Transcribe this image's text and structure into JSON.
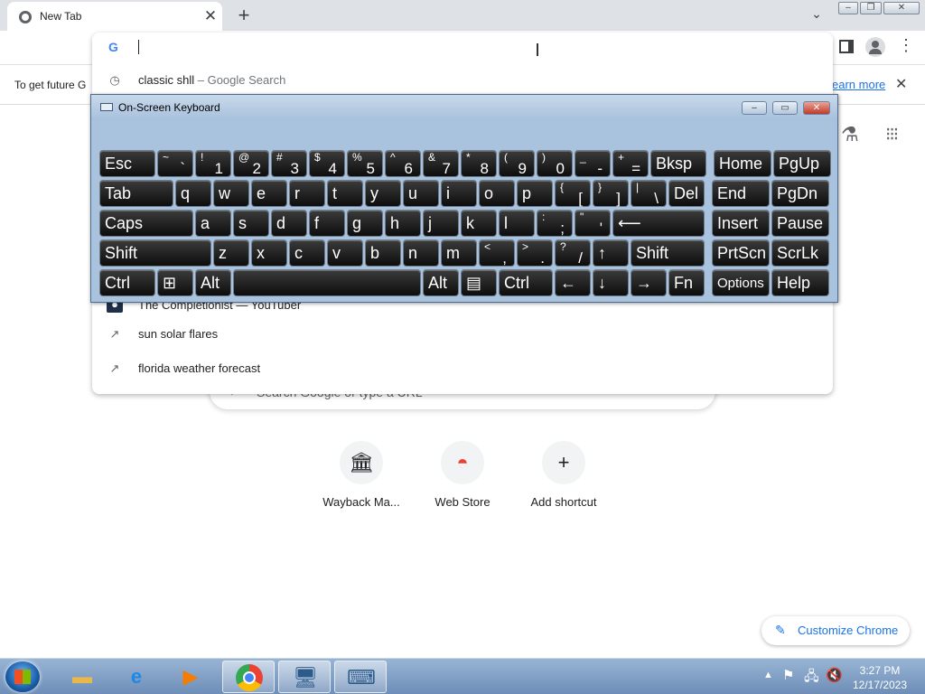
{
  "browser": {
    "tab_title": "New Tab",
    "omnibox_logo": "G",
    "info_text": "To get future G",
    "info_link": "earn more",
    "icons": [
      "chrome-icon",
      "close-icon",
      "plus-icon",
      "chevron-down-icon",
      "back-icon",
      "forward-icon",
      "reload-icon",
      "sidepanel-icon",
      "profile-icon",
      "menu-icon",
      "flask-icon",
      "apps-icon"
    ]
  },
  "omnibox": {
    "value": "",
    "suggestions": [
      {
        "text": "classic shll",
        "sub": " – Google Search",
        "icon": "history-icon"
      },
      {
        "text": "The Completionist — YouTuber",
        "sub": "",
        "icon": "person-icon"
      },
      {
        "text": "sun solar flares",
        "sub": "",
        "icon": "trending-icon"
      },
      {
        "text": "florida weather forecast",
        "sub": "",
        "icon": "trending-icon"
      }
    ]
  },
  "osk": {
    "title": "On-Screen Keyboard",
    "rows": [
      [
        {
          "m": "Esc"
        },
        {
          "s": "~",
          "m": "`"
        },
        {
          "s": "!",
          "m": "1"
        },
        {
          "s": "@",
          "m": "2"
        },
        {
          "s": "#",
          "m": "3"
        },
        {
          "s": "$",
          "m": "4"
        },
        {
          "s": "%",
          "m": "5"
        },
        {
          "s": "^",
          "m": "6"
        },
        {
          "s": "&",
          "m": "7"
        },
        {
          "s": "*",
          "m": "8"
        },
        {
          "s": "(",
          "m": "9"
        },
        {
          "s": ")",
          "m": "0"
        },
        {
          "s": "_",
          "m": "-"
        },
        {
          "s": "+",
          "m": "="
        },
        {
          "m": "Bksp"
        },
        {
          "m": "Home"
        },
        {
          "m": "PgUp"
        }
      ],
      [
        {
          "m": "Tab"
        },
        {
          "m": "q"
        },
        {
          "m": "w"
        },
        {
          "m": "e"
        },
        {
          "m": "r"
        },
        {
          "m": "t"
        },
        {
          "m": "y"
        },
        {
          "m": "u"
        },
        {
          "m": "i"
        },
        {
          "m": "o"
        },
        {
          "m": "p"
        },
        {
          "s": "{",
          "m": "["
        },
        {
          "s": "}",
          "m": "]"
        },
        {
          "s": "|",
          "m": "\\"
        },
        {
          "m": "Del"
        },
        {
          "m": "End"
        },
        {
          "m": "PgDn"
        }
      ],
      [
        {
          "m": "Caps"
        },
        {
          "m": "a"
        },
        {
          "m": "s"
        },
        {
          "m": "d"
        },
        {
          "m": "f"
        },
        {
          "m": "g"
        },
        {
          "m": "h"
        },
        {
          "m": "j"
        },
        {
          "m": "k"
        },
        {
          "m": "l"
        },
        {
          "s": ":",
          "m": ";"
        },
        {
          "s": "\"",
          "m": "'"
        },
        {
          "m": "⟵"
        },
        {
          "m": "Insert"
        },
        {
          "m": "Pause"
        }
      ],
      [
        {
          "m": "Shift"
        },
        {
          "m": "z"
        },
        {
          "m": "x"
        },
        {
          "m": "c"
        },
        {
          "m": "v"
        },
        {
          "m": "b"
        },
        {
          "m": "n"
        },
        {
          "m": "m"
        },
        {
          "s": "<",
          "m": ","
        },
        {
          "s": ">",
          "m": "."
        },
        {
          "s": "?",
          "m": "/"
        },
        {
          "m": "↑"
        },
        {
          "m": "Shift"
        },
        {
          "m": "PrtScn"
        },
        {
          "m": "ScrLk"
        }
      ],
      [
        {
          "m": "Ctrl"
        },
        {
          "m": "⊞"
        },
        {
          "m": "Alt"
        },
        {
          "m": ""
        },
        {
          "m": "Alt"
        },
        {
          "m": "▤"
        },
        {
          "m": "Ctrl"
        },
        {
          "m": "←"
        },
        {
          "m": "↓"
        },
        {
          "m": "→"
        },
        {
          "m": "Fn"
        },
        {
          "m": "Options"
        },
        {
          "m": "Help"
        }
      ]
    ]
  },
  "ntp": {
    "search_placeholder": "Search Google or type a URL",
    "shortcuts": [
      {
        "label": "Wayback Ma...",
        "icon": "wayback-icon",
        "glyph": "🏛"
      },
      {
        "label": "Web Store",
        "icon": "webstore-icon",
        "glyph": "◓"
      },
      {
        "label": "Add shortcut",
        "icon": "plus-icon",
        "glyph": "+"
      }
    ],
    "customize_label": "Customize Chrome"
  },
  "taskbar": {
    "time": "3:27 PM",
    "date": "12/17/2023",
    "apps": [
      "explorer-icon",
      "ie-icon",
      "media-player-icon",
      "chrome-icon",
      "remote-desktop-icon",
      "osk-icon"
    ]
  }
}
